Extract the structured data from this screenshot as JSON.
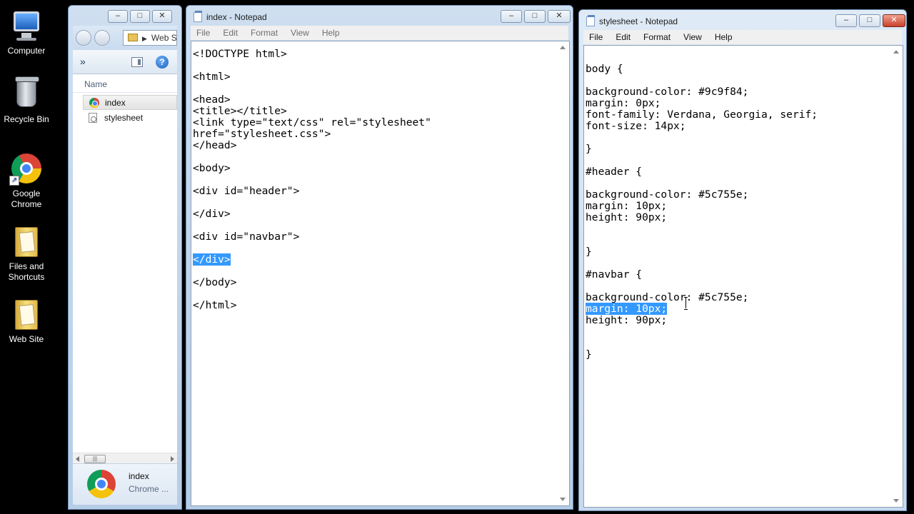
{
  "desktop": {
    "icons": [
      {
        "label": "Computer"
      },
      {
        "label": "Recycle Bin"
      },
      {
        "label": "Google Chrome"
      },
      {
        "label": "Files and Shortcuts"
      },
      {
        "label": "Web Site"
      }
    ]
  },
  "explorer": {
    "address": "Web S",
    "column_header": "Name",
    "files": [
      {
        "name": "index",
        "icon": "chrome-file-icon",
        "selected": true
      },
      {
        "name": "stylesheet",
        "icon": "css-file-icon",
        "selected": false
      }
    ],
    "details": {
      "name": "index",
      "type": "Chrome ..."
    },
    "caption": {
      "minimize": "–",
      "maximize": "□",
      "close": "✕"
    }
  },
  "index_notepad": {
    "title": "index - Notepad",
    "menu": [
      "File",
      "Edit",
      "Format",
      "View",
      "Help"
    ],
    "lines": [
      "<!DOCTYPE html>",
      "",
      "<html>",
      "",
      "<head>",
      "<title></title>",
      "<link type=\"text/css\" rel=\"stylesheet\"",
      "href=\"stylesheet.css\">",
      "</head>",
      "",
      "<body>",
      "",
      "<div id=\"header\">",
      "",
      "</div>",
      "",
      "<div id=\"navbar\">",
      "",
      "</div>",
      "",
      "</body>",
      "",
      "</html>"
    ],
    "selected_line": 18
  },
  "stylesheet_notepad": {
    "title": "stylesheet - Notepad",
    "menu": [
      "File",
      "Edit",
      "Format",
      "View",
      "Help"
    ],
    "lines": [
      "",
      "body {",
      "",
      "background-color: #9c9f84;",
      "margin: 0px;",
      "font-family: Verdana, Georgia, serif;",
      "font-size: 14px;",
      "",
      "}",
      "",
      "#header {",
      "",
      "background-color: #5c755e;",
      "margin: 10px;",
      "height: 90px;",
      "",
      "",
      "}",
      "",
      "#navbar {",
      "",
      "background-color: #5c755e;",
      "margin: 10px;",
      "height: 90px;",
      "",
      "",
      "}"
    ],
    "selected_line": 22
  },
  "colors": {
    "selection": "#3399ff",
    "window_frame": "#b6cde6",
    "close_button": "#c8402b"
  }
}
